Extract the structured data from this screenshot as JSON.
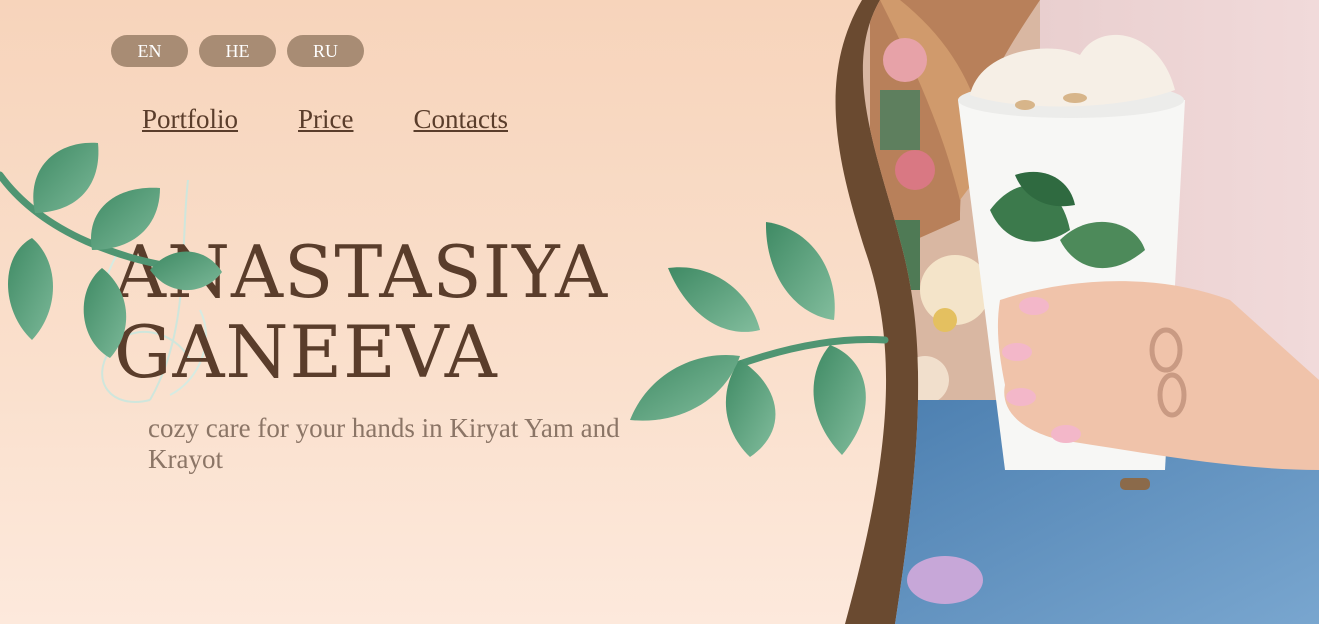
{
  "languages": [
    {
      "code": "EN"
    },
    {
      "code": "HE"
    },
    {
      "code": "RU"
    }
  ],
  "nav": {
    "portfolio": "Portfolio",
    "price": "Price",
    "contacts": "Contacts"
  },
  "hero": {
    "title_line1": "ANASTASIYA",
    "title_line2": "GANEEVA",
    "subtitle": "cozy care for your hands in Kiryat Yam and Krayot"
  },
  "colors": {
    "brand_brown": "#5a3d2b",
    "lang_button": "#a88c74",
    "leaf_green": "#5f9e7e",
    "curve_brown": "#6a4a30",
    "subtitle": "#8b7566"
  },
  "image": {
    "alt": "hands holding a coffee cup with manicure"
  }
}
